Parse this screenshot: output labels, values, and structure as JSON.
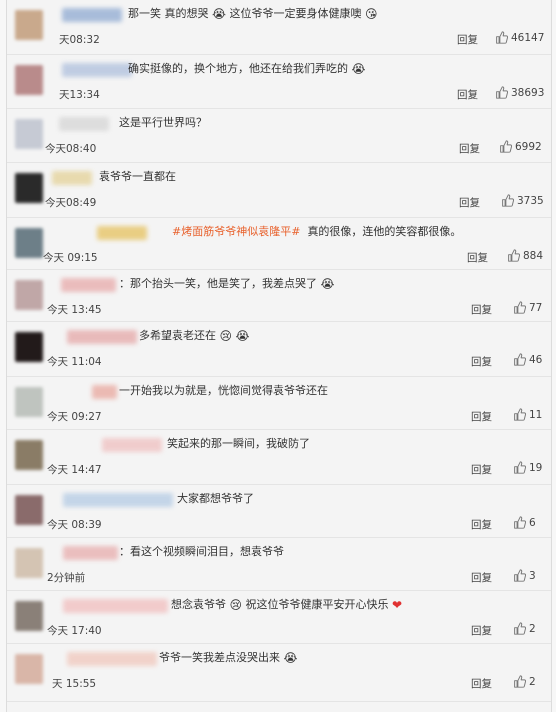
{
  "reply_label": "回复",
  "comments": [
    {
      "text_prefix": "那一笑 真的想哭",
      "emoji": "😭",
      "text_suffix": " 这位爷爷一定要身体健康噢",
      "emoji2": "😘",
      "time": "天08:32",
      "likes": "46147",
      "avatar_color": "#c9a98c",
      "nick_color": "#9bb3d6",
      "nick_w": 60
    },
    {
      "text_prefix": "确实挺像的，换个地方，他还在给我们弄吃的",
      "emoji": "😭",
      "text_suffix": "",
      "emoji2": "",
      "time": "天13:34",
      "likes": "38693",
      "avatar_color": "#b98b8b",
      "nick_color": "#b7c6e0",
      "nick_w": 70
    },
    {
      "text_prefix": "这是平行世界吗？",
      "emoji": "",
      "text_suffix": "",
      "emoji2": "",
      "time": "今天08:40",
      "likes": "6992",
      "avatar_color": "#c6cad4",
      "nick_color": "#d9d9d9",
      "nick_w": 50
    },
    {
      "text_prefix": "袁爷爷一直都在",
      "emoji": "",
      "text_suffix": "",
      "emoji2": "",
      "time": "今天08:49",
      "likes": "3735",
      "avatar_color": "#2a2a2a",
      "nick_color": "#e6d6a2",
      "nick_w": 40
    },
    {
      "text_prefix": "",
      "topic": "#烤面筋爷爷神似袁隆平#",
      "text_suffix": "真的很像，连他的笑容都很像。",
      "emoji": "",
      "emoji2": "",
      "time": "今天 09:15",
      "likes": "884",
      "avatar_color": "#6d7f88",
      "nick_color": "#e8c870",
      "nick_w": 50
    },
    {
      "text_prefix": "：那个抬头一笑，他是笑了，我差点哭了",
      "emoji": "😭",
      "text_suffix": "",
      "emoji2": "",
      "time": "今天 13:45",
      "likes": "77",
      "avatar_color": "#c0a7a7",
      "nick_color": "#e9b3b3",
      "nick_w": 55
    },
    {
      "text_prefix": "多希望袁老还在",
      "emoji": "😢",
      "text_suffix": "",
      "emoji2": "😭",
      "time": "今天 11:04",
      "likes": "46",
      "avatar_color": "#221a1a",
      "nick_color": "#e7b1b1",
      "nick_w": 70
    },
    {
      "text_prefix": "一开始我以为就是，恍惚间觉得袁爷爷还在",
      "emoji": "",
      "text_suffix": "",
      "emoji2": "",
      "time": "今天 09:27",
      "likes": "11",
      "avatar_color": "#bfc4bf",
      "nick_color": "#eab0a8",
      "nick_w": 25
    },
    {
      "text_prefix": "笑起来的那一瞬间，我破防了",
      "emoji": "",
      "text_suffix": "",
      "emoji2": "",
      "time": "今天 14:47",
      "likes": "19",
      "avatar_color": "#8a7c66",
      "nick_color": "#f0c6c6",
      "nick_w": 60
    },
    {
      "text_prefix": "大家都想爷爷了",
      "emoji": "",
      "text_suffix": "",
      "emoji2": "",
      "time": "今天 08:39",
      "likes": "6",
      "avatar_color": "#8a6b6b",
      "nick_color": "#bcd0e6",
      "nick_w": 110
    },
    {
      "text_prefix": "：看这个视频瞬间泪目，想袁爷爷",
      "emoji": "",
      "text_suffix": "",
      "emoji2": "",
      "time": "2分钟前",
      "likes": "3",
      "avatar_color": "#d4c4b3",
      "nick_color": "#e9b5b5",
      "nick_w": 55
    },
    {
      "text_prefix": "想念袁爷爷",
      "emoji": "😢",
      "text_suffix": "祝这位爷爷健康平安开心快乐",
      "emoji2": "❤",
      "time": "今天 17:40",
      "likes": "2",
      "avatar_color": "#8a8078",
      "nick_color": "#f2c4c4",
      "nick_w": 105
    },
    {
      "text_prefix": "爷爷一笑我差点没哭出来",
      "emoji": "😭",
      "text_suffix": "",
      "emoji2": "",
      "time": "天 15:55",
      "likes": "2",
      "avatar_color": "#d9b6a8",
      "nick_color": "#f1cdc3",
      "nick_w": 90
    }
  ]
}
